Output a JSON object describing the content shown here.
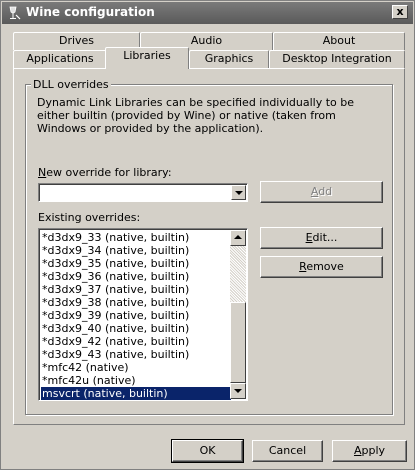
{
  "window": {
    "title": "Wine configuration",
    "close_label": "x"
  },
  "tabs": {
    "row_back": [
      "Drives",
      "Audio",
      "About"
    ],
    "row_front": [
      "Applications",
      "Libraries",
      "Graphics",
      "Desktop Integration"
    ],
    "active": "Libraries"
  },
  "group": {
    "title": "DLL overrides",
    "description": "Dynamic Link Libraries can be specified individually to be either builtin (provided by Wine) or native (taken from Windows or provided by the application)."
  },
  "new_override": {
    "label_prefix": "",
    "label_accel": "N",
    "label_rest": "ew override for library:",
    "value": ""
  },
  "add_button": {
    "accel": "A",
    "rest": "dd",
    "enabled": false
  },
  "existing": {
    "label": "Existing overrides:",
    "items": [
      "*d3dx9_33 (native, builtin)",
      "*d3dx9_34 (native, builtin)",
      "*d3dx9_35 (native, builtin)",
      "*d3dx9_36 (native, builtin)",
      "*d3dx9_37 (native, builtin)",
      "*d3dx9_38 (native, builtin)",
      "*d3dx9_39 (native, builtin)",
      "*d3dx9_40 (native, builtin)",
      "*d3dx9_42 (native, builtin)",
      "*d3dx9_43 (native, builtin)",
      "*mfc42 (native)",
      "*mfc42u (native)",
      "msvcrt (native, builtin)"
    ],
    "selected_index": 12
  },
  "edit_button": {
    "accel": "E",
    "rest": "dit..."
  },
  "remove_button": {
    "accel": "R",
    "rest": "emove"
  },
  "footer": {
    "ok": "OK",
    "cancel": "Cancel",
    "apply_accel": "A",
    "apply_rest": "pply"
  }
}
